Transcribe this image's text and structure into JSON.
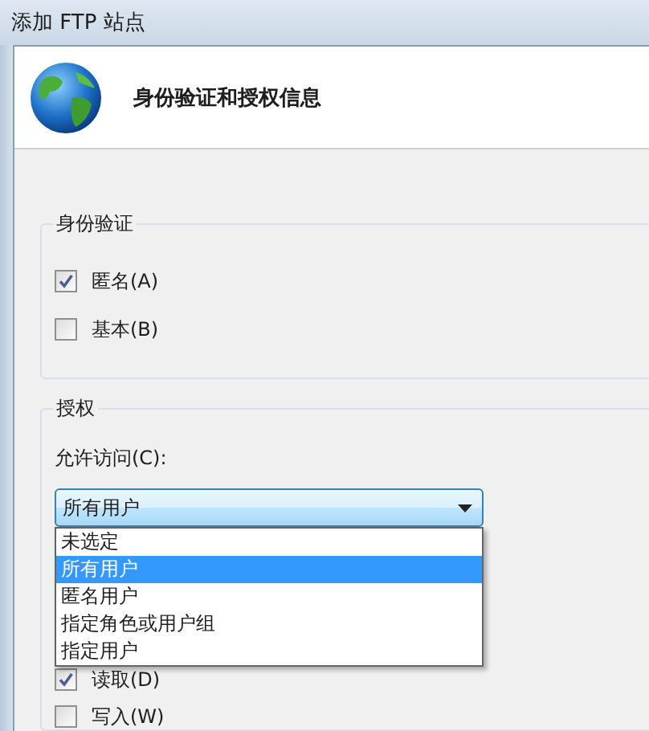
{
  "window": {
    "title": "添加 FTP 站点"
  },
  "header": {
    "title": "身份验证和授权信息"
  },
  "authentication": {
    "title": "身份验证",
    "options": [
      {
        "label": "匿名(A)",
        "checked": true
      },
      {
        "label": "基本(B)",
        "checked": false
      }
    ]
  },
  "authorization": {
    "title": "授权",
    "access": {
      "label": "允许访问(C):",
      "value": "所有用户",
      "expanded": true,
      "options": [
        {
          "label": "未选定",
          "selected": false
        },
        {
          "label": "所有用户",
          "selected": true
        },
        {
          "label": "匿名用户",
          "selected": false
        },
        {
          "label": "指定角色或用户组",
          "selected": false
        },
        {
          "label": "指定用户",
          "selected": false
        }
      ]
    },
    "permissions": [
      {
        "label": "读取(D)",
        "checked": true
      },
      {
        "label": "写入(W)",
        "checked": false
      }
    ]
  }
}
